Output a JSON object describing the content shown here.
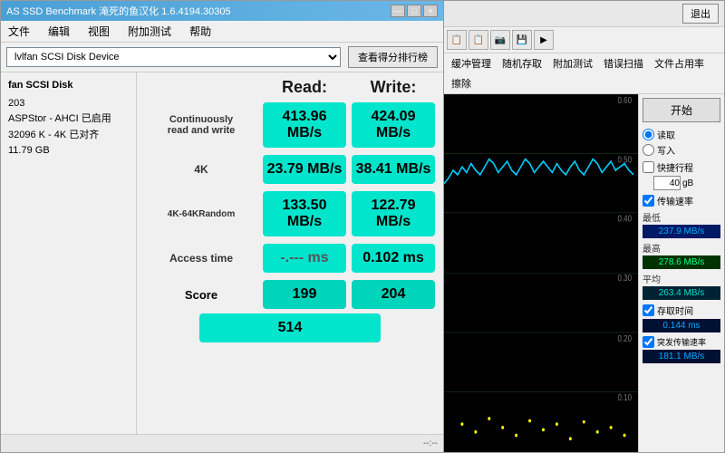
{
  "leftPanel": {
    "titleBar": {
      "title": "AS SSD Benchmark 滝死的鱼汉化 1.6.4194.30305",
      "buttons": [
        "—",
        "□",
        "×"
      ]
    },
    "menu": {
      "items": [
        "文件",
        "编辑",
        "视图",
        "附加测试",
        "帮助"
      ]
    },
    "toolbar": {
      "driveLabel": "lvlfan  SCSI Disk Device",
      "scoreBtnLabel": "查看得分排行榜"
    },
    "diskInfo": {
      "title": "fan SCSI Disk",
      "lines": [
        "203",
        "ASPStor - AHCI 已启用",
        "32096 K - 4K 已对齐",
        "11.79 GB"
      ]
    },
    "benchTable": {
      "readLabel": "Read:",
      "writeLabel": "Write:",
      "rows": [
        {
          "label": "Continuously\nread and write",
          "read": "413.96 MB/s",
          "write": "424.09 MB/s"
        },
        {
          "label": "4K",
          "read": "23.79 MB/s",
          "write": "38.41 MB/s"
        },
        {
          "label": "4K-64KRandom",
          "read": "133.50 MB/s",
          "write": "122.79 MB/s"
        },
        {
          "label": "Access time",
          "read": "-.--- ms",
          "write": "0.102 ms"
        }
      ],
      "scoreRow": {
        "label": "Score",
        "read": "199",
        "write": "204",
        "total": "514"
      }
    },
    "bottomBar": {
      "text": "--:--"
    }
  },
  "rightPanel": {
    "titleBar": {
      "exitLabel": "退出"
    },
    "toolbar": {
      "icons": [
        "📋",
        "📋",
        "📷",
        "💾",
        "▶"
      ]
    },
    "tabs": {
      "items": [
        "缓冲管理",
        "随机存取",
        "附加测试",
        "错误扫描",
        "文件占用率",
        "擦除"
      ]
    },
    "controls": {
      "startLabel": "开始",
      "radioOptions": [
        "读取",
        "写入"
      ],
      "checkboxes": [
        "快捷行程"
      ],
      "gbValue": "40",
      "gbUnit": "gB",
      "speedCheckLabel": "传输速率",
      "minLabel": "最低",
      "minValue": "237.9 MB/s",
      "maxLabel": "最高",
      "maxValue": "278.6 MB/s",
      "avgLabel": "平均",
      "avgValue": "263.4 MB/s",
      "accessTimeLabel": "存取时间",
      "accessTimeValue": "0.144 ms",
      "burstLabel": "突发传输速率",
      "burstValue": "181.1 MB/s"
    },
    "chart": {
      "yLabels": [
        "0.60",
        "0.50",
        "0.40",
        "0.30",
        "0.20",
        "0.10"
      ]
    }
  }
}
